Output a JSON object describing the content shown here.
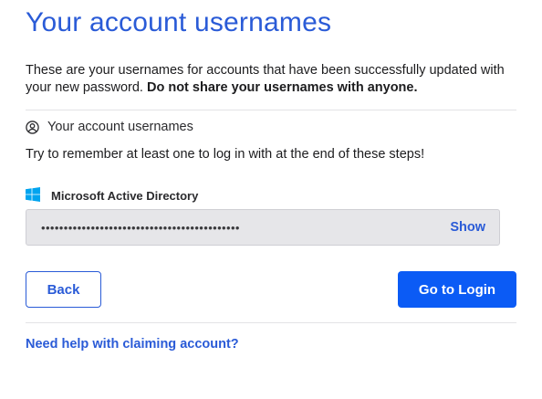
{
  "page": {
    "title": "Your account usernames",
    "intro_text": "These are your usernames for accounts that have been successfully updated with your new password. ",
    "intro_bold": "Do not share your usernames with anyone."
  },
  "section": {
    "icon": "user-circle-icon",
    "heading": "Your account usernames",
    "hint": "Try to remember at least one to log in with at the end of these steps!"
  },
  "account": {
    "provider_icon": "windows-logo-icon",
    "provider_name": "Microsoft Active Directory",
    "masked_username": "••••••••••••••••••••••••••••••••••••••••••••",
    "show_label": "Show"
  },
  "actions": {
    "back_label": "Back",
    "login_label": "Go to Login"
  },
  "footer": {
    "help_link": "Need help with claiming account?"
  },
  "colors": {
    "accent": "#2a5bd7",
    "primary_button": "#0b5bf5",
    "windows_blue": "#00a4ef",
    "field_bg": "#e6e6e9"
  }
}
